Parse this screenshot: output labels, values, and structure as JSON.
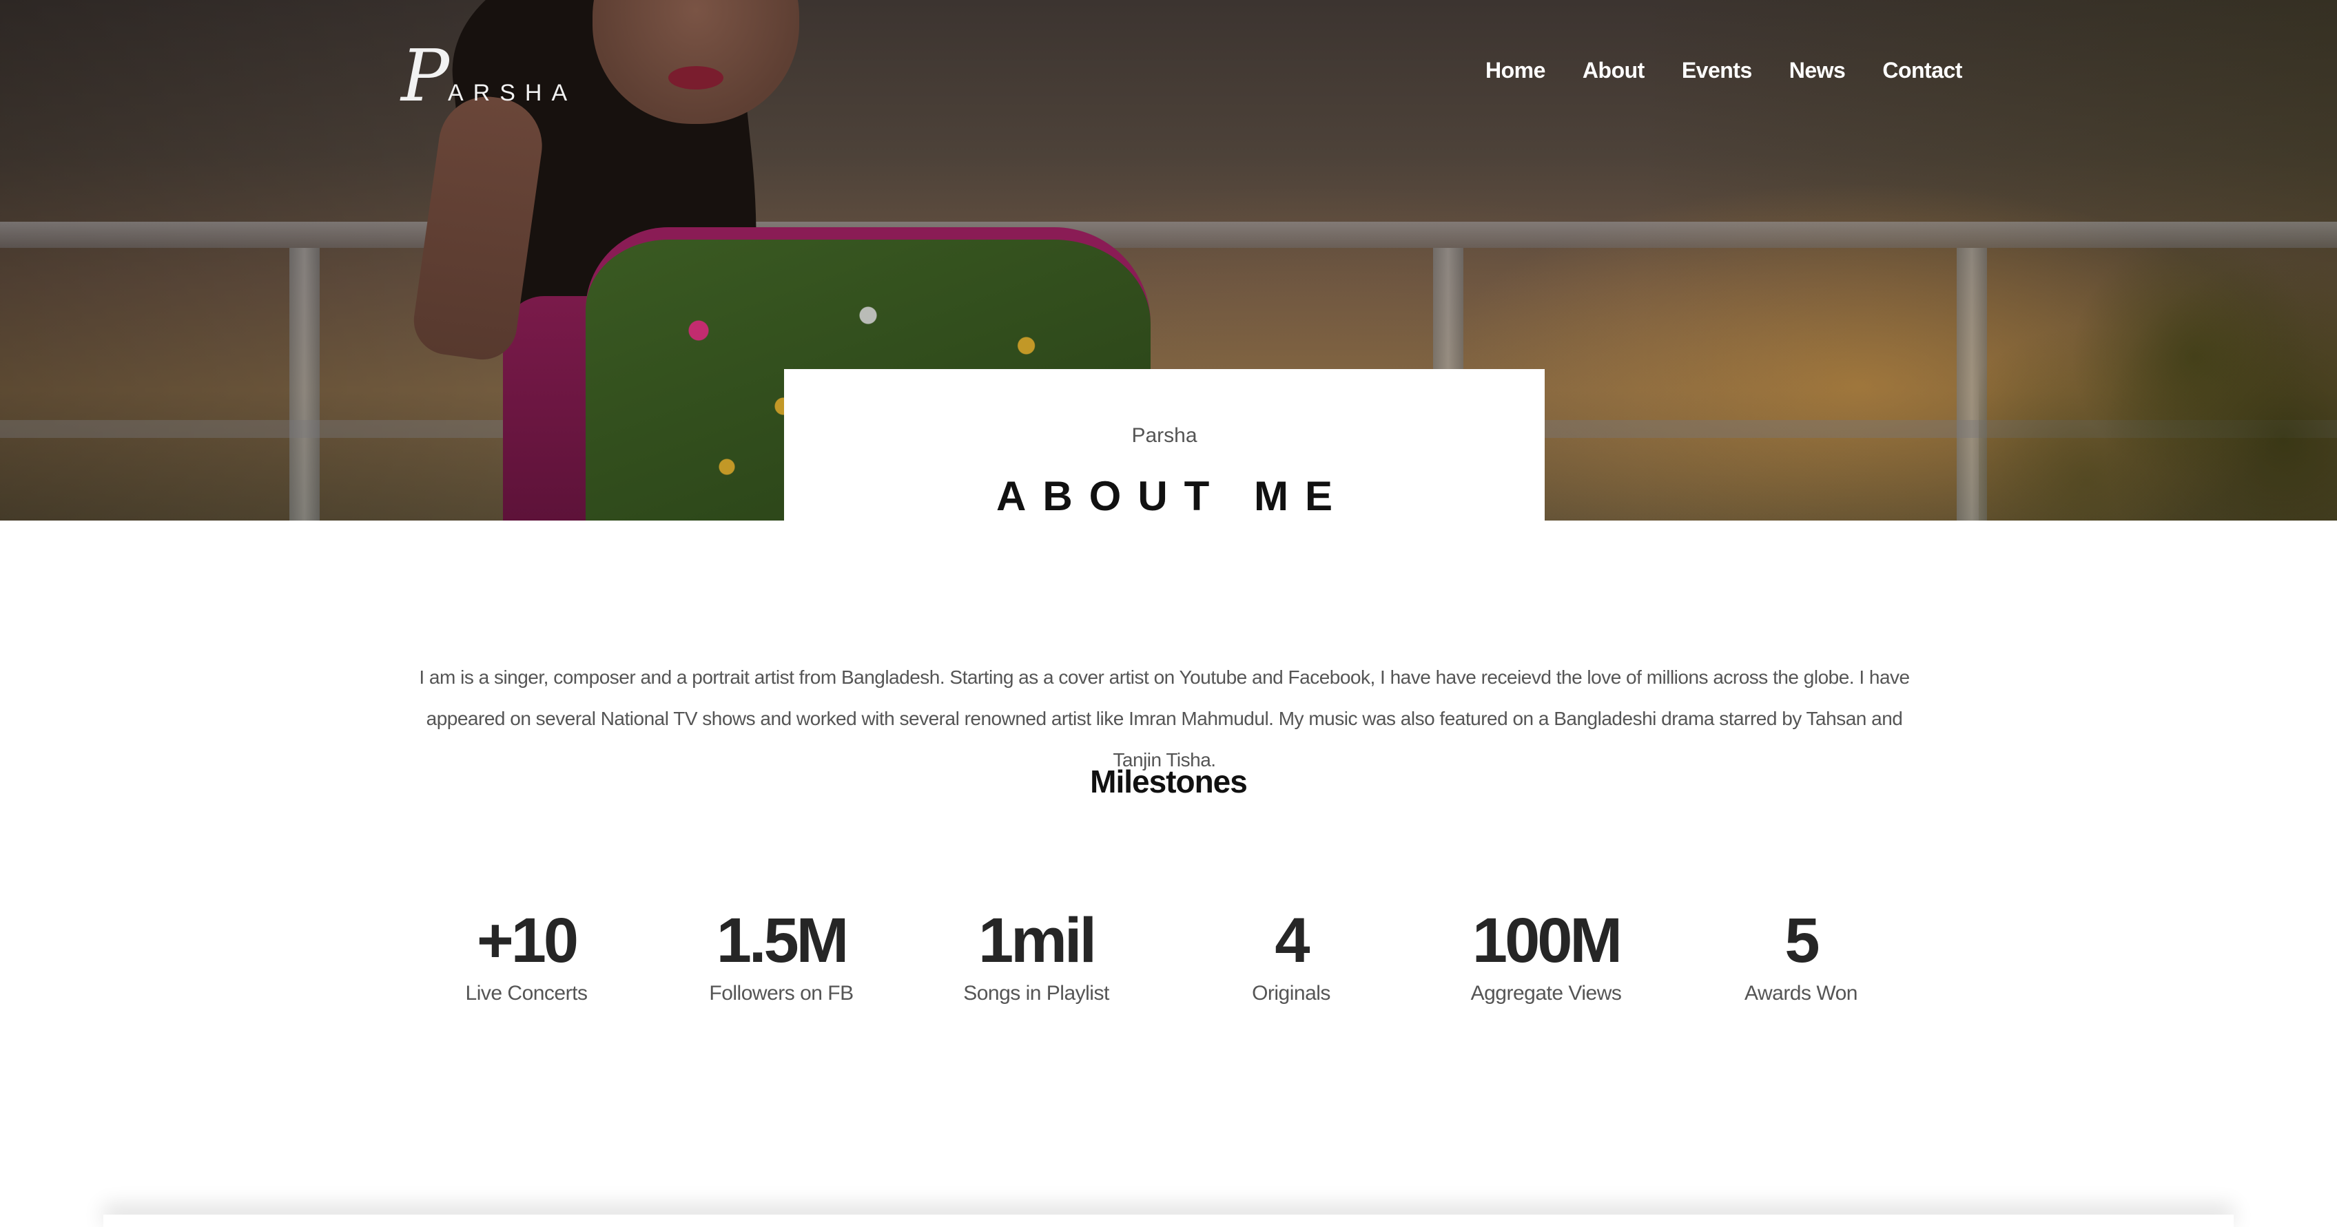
{
  "brand": {
    "logo_initial": "P",
    "logo_rest": "ARSHA"
  },
  "nav": {
    "items": [
      "Home",
      "About",
      "Events",
      "News",
      "Contact"
    ]
  },
  "title_card": {
    "subtitle": "Parsha",
    "heading": "ABOUT ME"
  },
  "bio": {
    "text": "I am is a singer, composer and a portrait artist from Bangladesh. Starting as a cover artist on Youtube and Facebook, I have have receievd the love of millions across the globe. I have appeared on several National TV shows and worked with several renowned artist like Imran Mahmudul. My music was also featured on a Bangladeshi drama starred by Tahsan and Tanjin Tisha."
  },
  "milestones": {
    "title": "Milestones",
    "items": [
      {
        "value": "+10",
        "label": "Live Concerts"
      },
      {
        "value": "1.5M",
        "label": "Followers on FB"
      },
      {
        "value": "1mil",
        "label": "Songs in Playlist"
      },
      {
        "value": "4",
        "label": "Originals"
      },
      {
        "value": "100M",
        "label": "Aggregate Views"
      },
      {
        "value": "5",
        "label": "Awards Won"
      }
    ]
  }
}
